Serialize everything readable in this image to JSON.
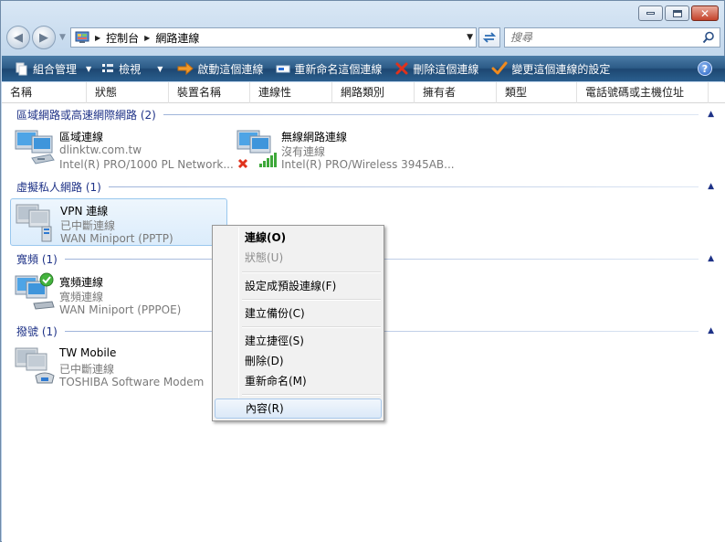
{
  "window": {
    "buttons": {
      "minimize": "minimize",
      "maximize": "maximize",
      "close": "✕"
    }
  },
  "address_bar": {
    "crumbs": [
      "控制台",
      "網路連線"
    ],
    "search_placeholder": "搜尋"
  },
  "command_bar": {
    "organize": "組合管理",
    "views": "檢視",
    "start": "啟動這個連線",
    "rename": "重新命名這個連線",
    "delete": "刪除這個連線",
    "change": "變更這個連線的設定",
    "help": "?"
  },
  "columns": [
    "名稱",
    "狀態",
    "裝置名稱",
    "連線性",
    "網路類別",
    "擁有者",
    "類型",
    "電話號碼或主機位址"
  ],
  "groups": [
    {
      "title": "區域網路或高速網際網路 (2)",
      "items": [
        {
          "name": "區域連線",
          "status": "dlinktw.com.tw",
          "device": "Intel(R) PRO/1000 PL Network..."
        },
        {
          "name": "無線網路連線",
          "status": "沒有連線",
          "device": "Intel(R) PRO/Wireless 3945AB..."
        }
      ]
    },
    {
      "title": "虛擬私人網路 (1)",
      "items": [
        {
          "name": "VPN 連線",
          "status": "已中斷連線",
          "device": "WAN Miniport (PPTP)"
        }
      ]
    },
    {
      "title": "寬頻 (1)",
      "items": [
        {
          "name": "寬頻連線",
          "status": "寬頻連線",
          "device": "WAN Miniport (PPPOE)"
        }
      ]
    },
    {
      "title": "撥號 (1)",
      "items": [
        {
          "name": "TW Mobile",
          "status": "已中斷連線",
          "device": "TOSHIBA Software Modem"
        }
      ]
    }
  ],
  "context_menu": {
    "connect": "連線(O)",
    "status": "狀態(U)",
    "set_default": "設定成預設連線(F)",
    "backup": "建立備份(C)",
    "shortcut": "建立捷徑(S)",
    "delete": "刪除(D)",
    "rename": "重新命名(M)",
    "properties": "內容(R)"
  },
  "colors": {
    "group_header": "#1e3287",
    "command_bar": "#2c5b87",
    "selection": "#dbecfb"
  }
}
